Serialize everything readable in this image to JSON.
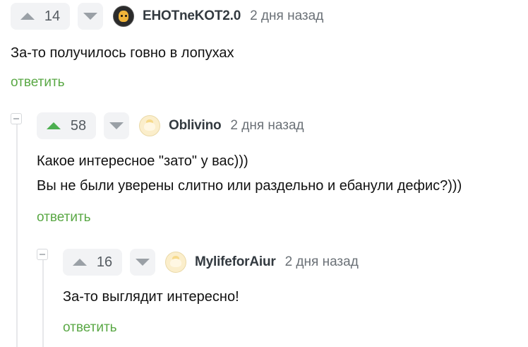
{
  "comments": [
    {
      "score": "14",
      "author": "EHOTneKOT2.0",
      "time": "2 дня назад",
      "lines": [
        "За-то получилось говно в лопухах"
      ],
      "reply_label": "ответить"
    },
    {
      "score": "58",
      "author": "Oblivino",
      "time": "2 дня назад",
      "lines": [
        "Какое интересное \"зато\" у вас)))",
        "Вы не были уверены слитно или раздельно и ебанули дефис?)))"
      ],
      "reply_label": "ответить"
    },
    {
      "score": "16",
      "author": "MylifeforAiur",
      "time": "2 дня назад",
      "lines": [
        "За-то выглядит интересно!"
      ],
      "reply_label": "ответить"
    }
  ],
  "colors": {
    "upvote_active": "#4caf50",
    "reply_link": "#5aa845"
  },
  "icons": {
    "upvote": "triangle-up-icon",
    "downvote": "triangle-down-icon",
    "collapse": "minus-square-icon"
  }
}
